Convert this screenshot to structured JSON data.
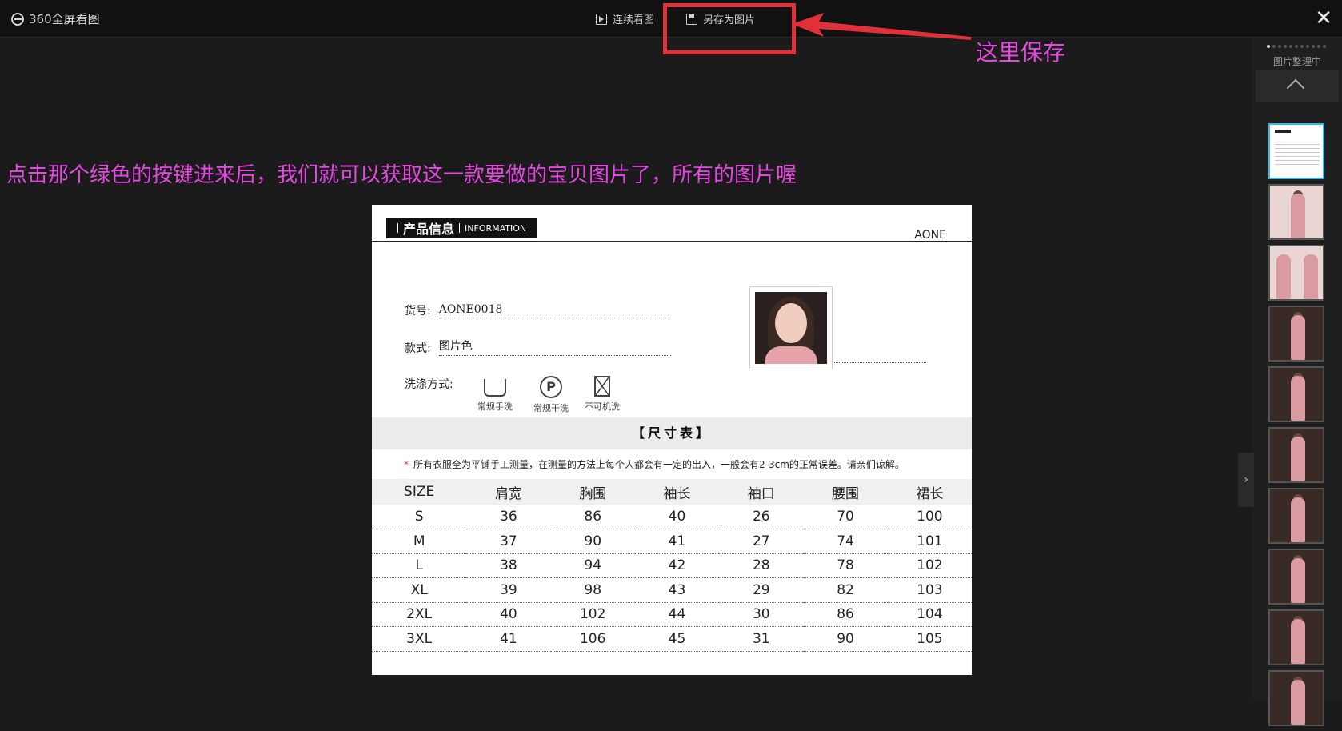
{
  "app": {
    "title": "360全屏看图"
  },
  "toolbar": {
    "slideshow_label": "连续看图",
    "save_as_label": "另存为图片",
    "close_symbol": "✕"
  },
  "annotations": {
    "save_here": "这里保存",
    "instruction": "点击那个绿色的按键进来后，我们就可以获取这一款要做的宝贝图片了，所有的图片喔",
    "highlight_color": "#e0303a",
    "text_color": "#e448e0"
  },
  "sidebar": {
    "status": "图片整理中",
    "scroll_up_symbol": "up-chevron-icon",
    "toggle_symbol": "›",
    "thumbnails": [
      {
        "kind": "size-table",
        "selected": true
      },
      {
        "kind": "model-pink",
        "selected": false
      },
      {
        "kind": "detail-pink",
        "selected": false
      },
      {
        "kind": "model-night",
        "selected": false
      },
      {
        "kind": "model-night",
        "selected": false
      },
      {
        "kind": "model-night",
        "selected": false
      },
      {
        "kind": "model-night",
        "selected": false
      },
      {
        "kind": "model-night",
        "selected": false
      },
      {
        "kind": "model-night",
        "selected": false
      },
      {
        "kind": "model-night",
        "selected": false
      }
    ]
  },
  "product": {
    "header_zh": "产品信息",
    "header_en": "INFORMATION",
    "brand": "AONE",
    "item_no_label": "货号:",
    "item_no_value": "AONE0018",
    "style_label": "款式:",
    "style_value": "图片色",
    "wash_label": "洗涤方式:",
    "wash_icons": [
      {
        "label": "常规手洗",
        "icon": "hand-wash-icon"
      },
      {
        "label": "常规干洗",
        "icon": "dry-clean-icon",
        "glyph": "P"
      },
      {
        "label": "不可机洗",
        "icon": "no-machine-wash-icon"
      }
    ],
    "size_title": "【尺寸表】",
    "size_note_star": "*",
    "size_note": "所有衣服全为平铺手工测量，在测量的方法上每个人都会有一定的出入，一般会有2-3cm的正常误差。请亲们谅解。",
    "size_table": {
      "headers": [
        "SIZE",
        "肩宽",
        "胸围",
        "袖长",
        "袖口",
        "腰围",
        "裙长"
      ],
      "rows": [
        [
          "S",
          "36",
          "86",
          "40",
          "26",
          "70",
          "100"
        ],
        [
          "M",
          "37",
          "90",
          "41",
          "27",
          "74",
          "101"
        ],
        [
          "L",
          "38",
          "94",
          "42",
          "28",
          "78",
          "102"
        ],
        [
          "XL",
          "39",
          "98",
          "43",
          "29",
          "82",
          "103"
        ],
        [
          "2XL",
          "40",
          "102",
          "44",
          "30",
          "86",
          "104"
        ],
        [
          "3XL",
          "41",
          "106",
          "45",
          "31",
          "90",
          "105"
        ]
      ]
    }
  }
}
